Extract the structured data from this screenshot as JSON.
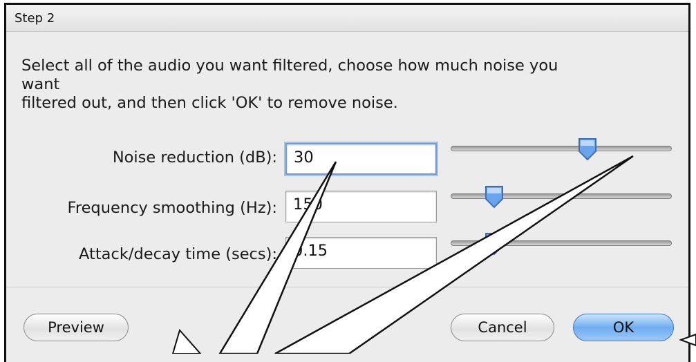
{
  "window": {
    "title": "Step 2"
  },
  "instructions": {
    "line1": "Select all of the audio you want filtered, choose how much noise you",
    "line2": "want",
    "line3": "filtered out, and then click 'OK' to remove noise."
  },
  "controls": [
    {
      "label": "Noise reduction (dB):",
      "value": "30",
      "slider_level": 0.62
    },
    {
      "label": "Frequency smoothing (Hz):",
      "value": "150",
      "slider_level": 0.2
    },
    {
      "label": "Attack/decay time (secs):",
      "value": "0.15",
      "slider_level": 0.2
    }
  ],
  "buttons": {
    "preview": "Preview",
    "cancel": "Cancel",
    "ok": "OK"
  },
  "colors": {
    "focus_ring": "#6f9ad6",
    "default_button": "#70acf3",
    "slider_thumb": "#6aa4ef"
  }
}
